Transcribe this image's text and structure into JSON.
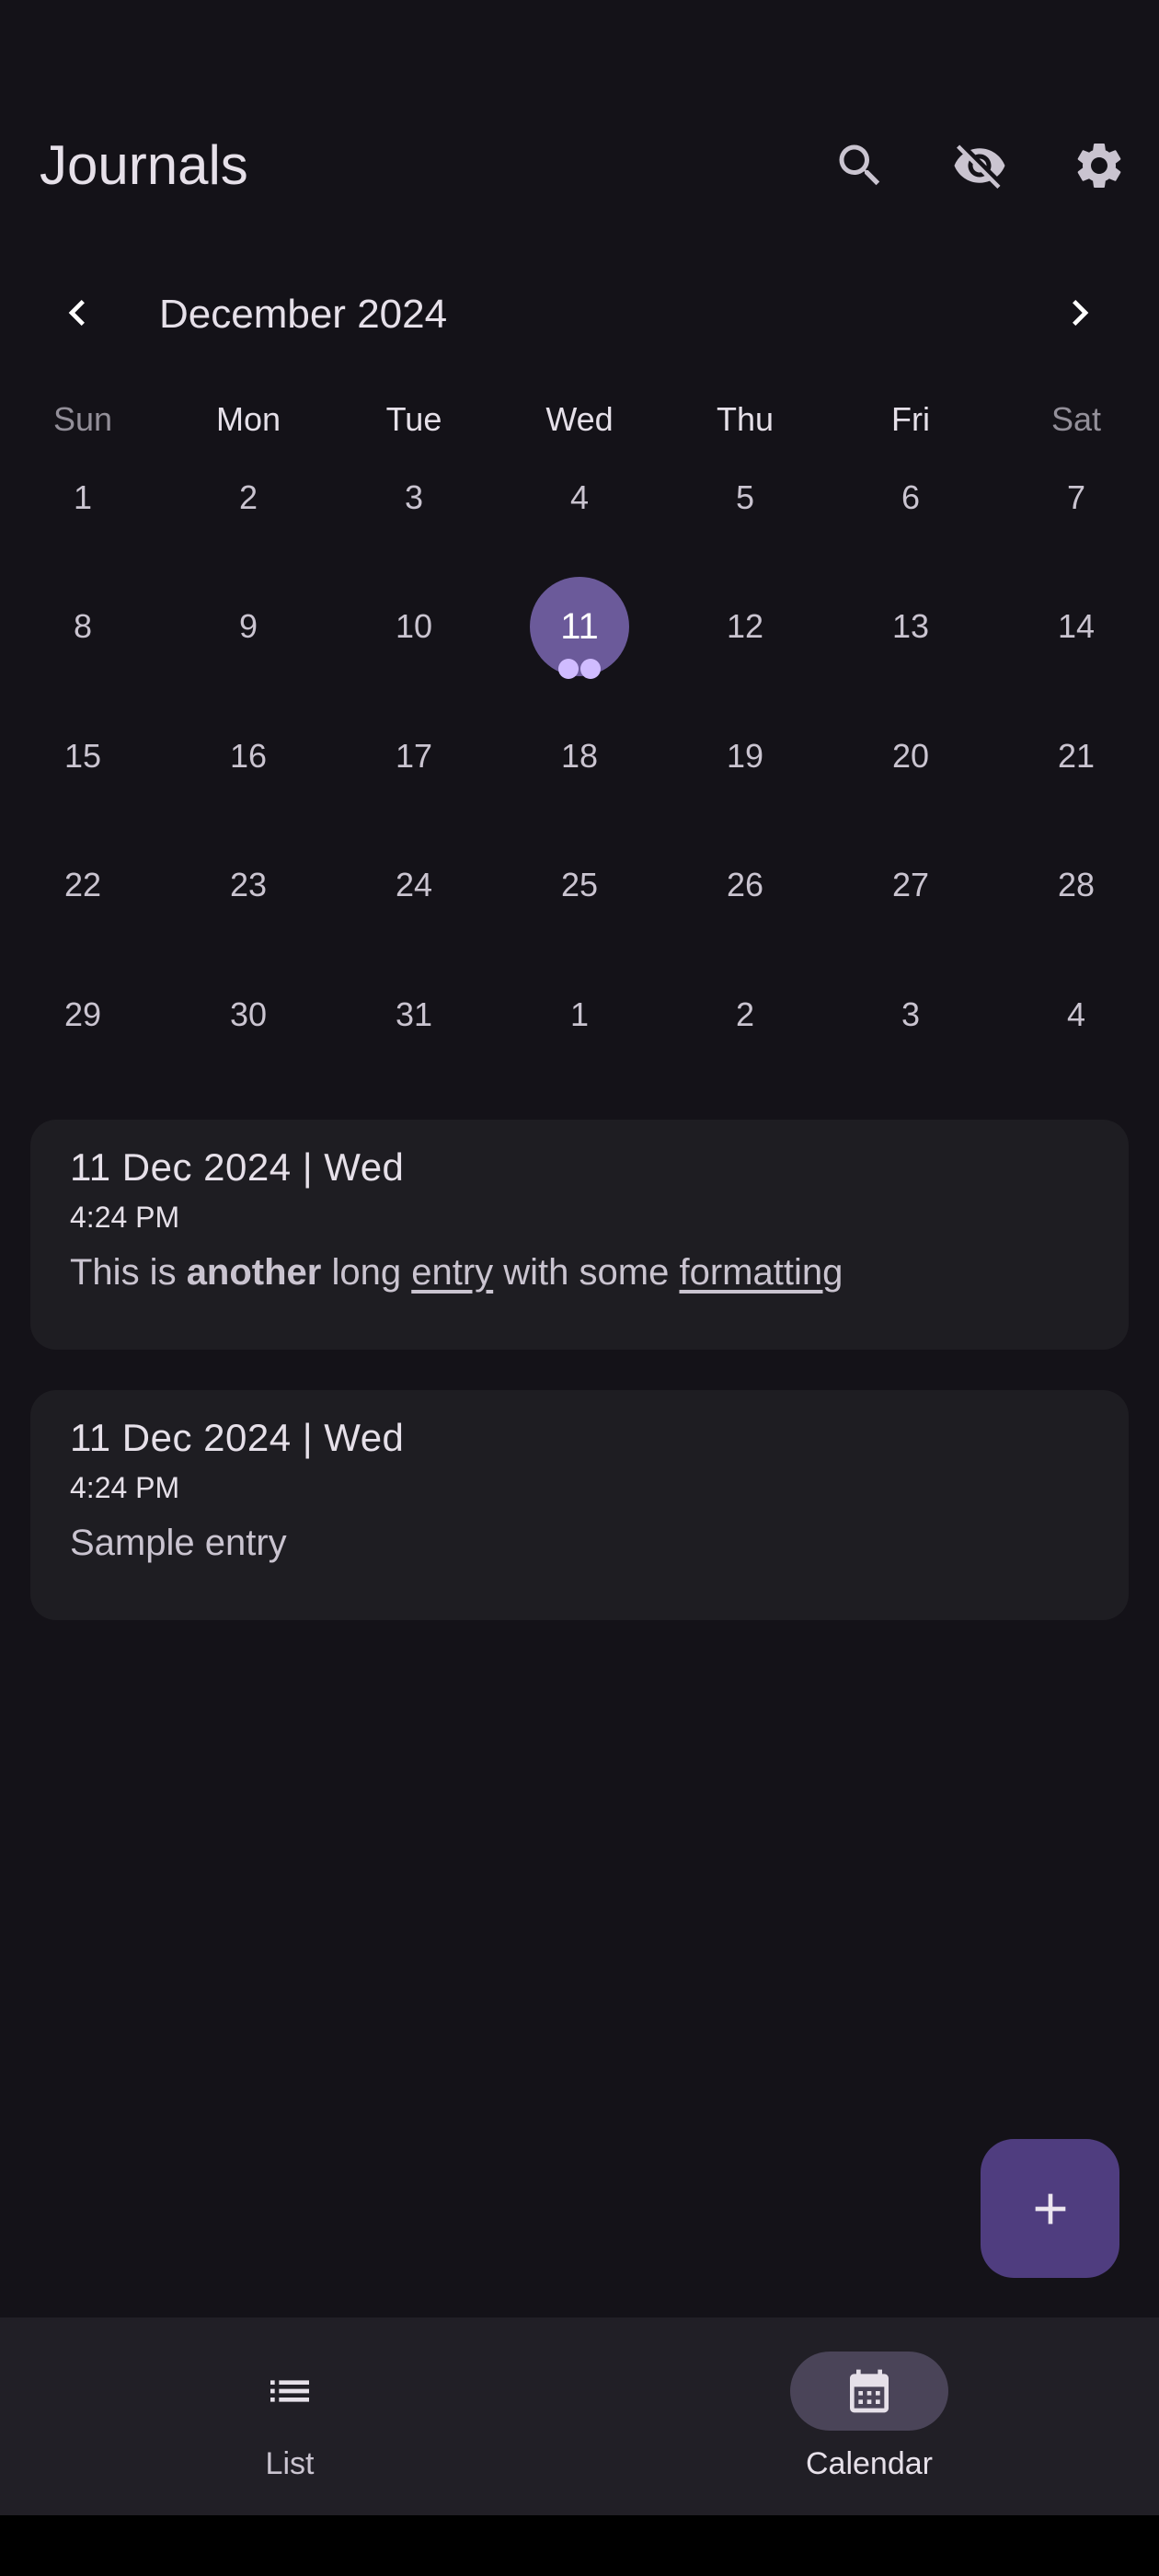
{
  "app": {
    "title": "Journals"
  },
  "calendar": {
    "month_label": "December 2024",
    "weekdays": [
      "Sun",
      "Mon",
      "Tue",
      "Wed",
      "Thu",
      "Fri",
      "Sat"
    ],
    "weeks": [
      [
        "1",
        "2",
        "3",
        "4",
        "5",
        "6",
        "7"
      ],
      [
        "8",
        "9",
        "10",
        "11",
        "12",
        "13",
        "14"
      ],
      [
        "15",
        "16",
        "17",
        "18",
        "19",
        "20",
        "21"
      ],
      [
        "22",
        "23",
        "24",
        "25",
        "26",
        "27",
        "28"
      ],
      [
        "29",
        "30",
        "31",
        "1",
        "2",
        "3",
        "4"
      ]
    ],
    "selected_day": "11",
    "selected_day_entry_count": 2
  },
  "entries": [
    {
      "date": "11 Dec 2024 | Wed",
      "time": "4:24 PM",
      "body_parts": [
        "This is ",
        "another",
        " long ",
        "entry",
        " with some ",
        "formatting"
      ]
    },
    {
      "date": "11 Dec 2024 | Wed",
      "time": "4:24 PM",
      "body": "Sample entry"
    }
  ],
  "bottom_nav": {
    "items": [
      {
        "label": "List",
        "icon": "list-icon"
      },
      {
        "label": "Calendar",
        "icon": "calendar-icon",
        "active": true
      }
    ]
  },
  "colors": {
    "background": "#141218",
    "selected_day": "#6b5a9a",
    "fab": "#4f3d7f",
    "card": "#1e1d22",
    "nav_bar": "#211f26"
  }
}
